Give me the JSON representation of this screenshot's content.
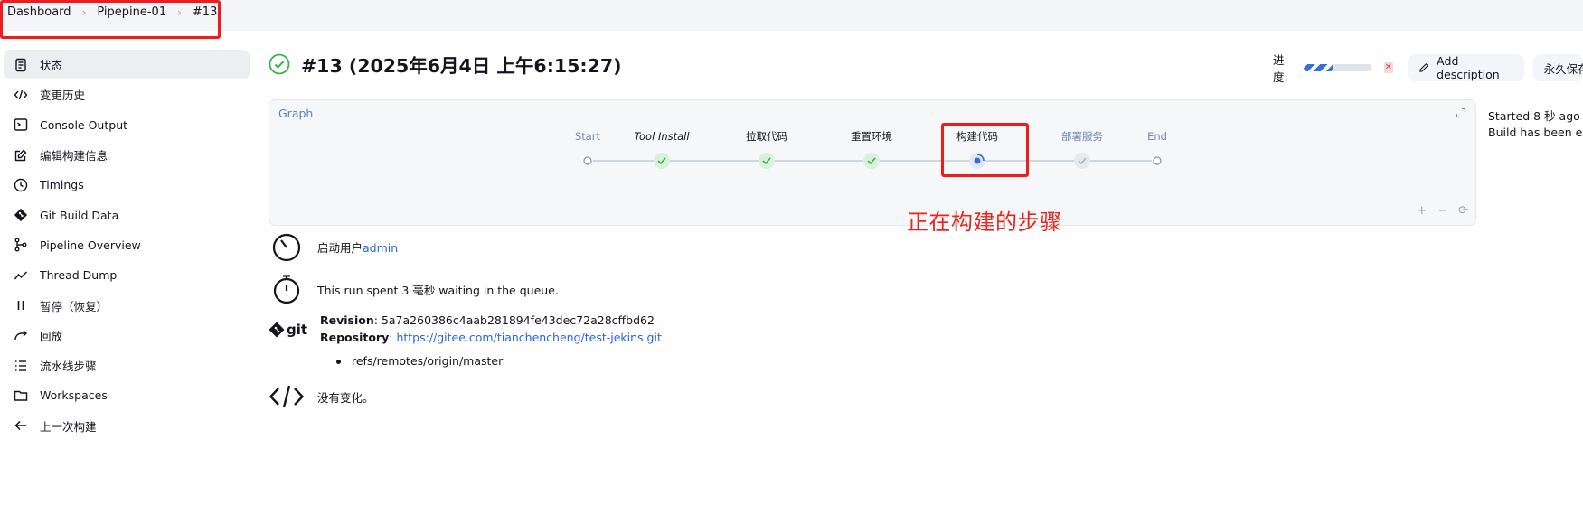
{
  "breadcrumb": [
    "Dashboard",
    "Pipepine-01",
    "#13"
  ],
  "sidebar": {
    "items": [
      {
        "label": "状态",
        "icon": "document-icon",
        "active": true
      },
      {
        "label": "变更历史",
        "icon": "code-icon"
      },
      {
        "label": "Console Output",
        "icon": "terminal-icon"
      },
      {
        "label": "编辑构建信息",
        "icon": "edit-icon"
      },
      {
        "label": "Timings",
        "icon": "clock-icon"
      },
      {
        "label": "Git Build Data",
        "icon": "git-icon"
      },
      {
        "label": "Pipeline Overview",
        "icon": "pipeline-icon"
      },
      {
        "label": "Thread Dump",
        "icon": "chart-line-icon"
      },
      {
        "label": "暂停（恢复）",
        "icon": "pause-icon"
      },
      {
        "label": "回放",
        "icon": "replay-icon"
      },
      {
        "label": "流水线步骤",
        "icon": "list-icon"
      },
      {
        "label": "Workspaces",
        "icon": "folder-icon"
      },
      {
        "label": "上一次构建",
        "icon": "arrow-left-icon"
      }
    ]
  },
  "build": {
    "title": "#13 (2025年6月4日 上午6:15:27)",
    "status": "success"
  },
  "actions": {
    "progress_label": "进度:",
    "progress_fraction": 0.45,
    "add_description": "Add description",
    "keep_forever": "永久保存"
  },
  "graph": {
    "label": "Graph",
    "stages": [
      {
        "name": "Start",
        "state": "start"
      },
      {
        "name": "Tool Install",
        "state": "success"
      },
      {
        "name": "拉取代码",
        "state": "success"
      },
      {
        "name": "重置环境",
        "state": "success"
      },
      {
        "name": "构建代码",
        "state": "running"
      },
      {
        "name": "部署服务",
        "state": "pending"
      },
      {
        "name": "End",
        "state": "end"
      }
    ],
    "zoom": [
      "+",
      "−",
      "⟳"
    ]
  },
  "annotation": "正在构建的步骤",
  "info": {
    "started": "Started 8 秒 ago",
    "build_exec": "Build has been executing"
  },
  "details": {
    "started_by_prefix": "启动用户",
    "started_by_user": "admin",
    "queue_text": "This run spent 3 毫秒 waiting in the queue.",
    "revision_label": "Revision",
    "revision_value": "5a7a260386c4aab281894fe43dec72a28cffbd62",
    "repository_label": "Repository",
    "repository_value": "https://gitee.com/tianchencheng/test-jekins.git",
    "ref": "refs/remotes/origin/master",
    "no_changes": "没有变化。",
    "git_wordmark": "git"
  },
  "colors": {
    "success": "#37b24d",
    "running": "#3a70d6",
    "annotation_red": "#e8251f",
    "link": "#2563eb"
  }
}
